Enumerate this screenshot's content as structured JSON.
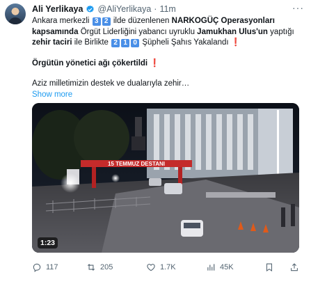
{
  "author": {
    "name": "Ali Yerlikaya",
    "handle": "@AliYerlikaya",
    "dot": "·",
    "time": "11m",
    "verified_icon": "verified-badge-icon"
  },
  "menu_icon": "more-icon",
  "text": {
    "l1_a": "Ankara merkezli",
    "n1": "3",
    "n2": "2",
    "l1_b": "ilde düzenlenen",
    "l1_c": "NARKOGÜÇ Operasyonları",
    "l2_a": "kapsamında",
    "l2_b": "Örgüt Liderliğini yabancı uyruklu",
    "l2_c": "Jamukhan Ulus'un",
    "l2_d": "yaptığı",
    "l3_a": "zehir taciri",
    "l3_b": "ile Birlikte",
    "n3": "2",
    "n4": "1",
    "n5": "0",
    "l3_c": "Şüpheli Şahıs Yakalandı",
    "l3_d": "❗",
    "l4": "Örgütün yönetici ağı çökertildi",
    "l4_mark": "❗",
    "l5": "Aziz milletimizin destek ve dualarıyla zehir…",
    "show_more": "Show more"
  },
  "video": {
    "duration": "1:23",
    "banner": "15 TEMMUZ DESTANI"
  },
  "actions": {
    "replies": "117",
    "reposts": "205",
    "likes": "1.7K",
    "views": "45K"
  }
}
